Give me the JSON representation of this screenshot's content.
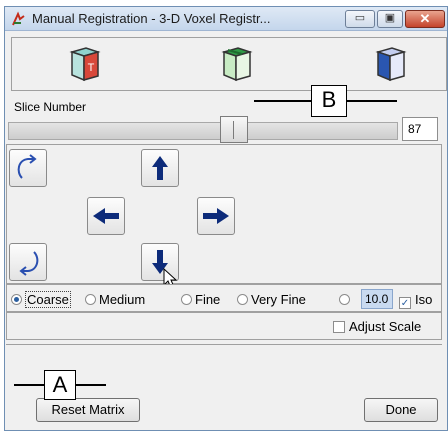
{
  "window": {
    "title": "Manual Registration - 3-D Voxel Registr...",
    "titlebar_buttons": [
      "minimize-icon",
      "maximize-icon",
      "close-icon"
    ],
    "close_glyph": "✕"
  },
  "view_buttons": [
    {
      "name": "axial-view-button",
      "icon": "cube-front-face-icon",
      "face_color": "#d7483a",
      "letter": "T"
    },
    {
      "name": "coronal-view-button",
      "icon": "cube-front-face-icon",
      "face_color": "#2f9a45"
    },
    {
      "name": "sagittal-view-button",
      "icon": "cube-side-face-icon",
      "face_color": "#2a56b0"
    }
  ],
  "slice": {
    "label": "Slice Number",
    "value": "87"
  },
  "nav": {
    "buttons": [
      "rotate-clockwise-icon",
      "move-up-icon",
      "move-left-icon",
      "move-right-icon",
      "rotate-counterclockwise-icon",
      "move-down-icon"
    ]
  },
  "step_options": {
    "radios": [
      {
        "label": "Coarse",
        "selected": true
      },
      {
        "label": "Medium",
        "selected": false
      },
      {
        "label": "Fine",
        "selected": false
      },
      {
        "label": "Very Fine",
        "selected": false
      },
      {
        "label": "",
        "selected": false
      }
    ],
    "custom_value": "10.0",
    "iso_label": "Iso",
    "iso_checked": true
  },
  "adjust_scale": {
    "label": "Adjust Scale",
    "checked": false
  },
  "buttons": {
    "reset_label": "Reset Matrix",
    "done_label": "Done"
  },
  "callouts": {
    "a": "A",
    "b": "B"
  },
  "colors": {
    "accent": "#2b5fa0",
    "selection_fill": "#c9daf0"
  }
}
